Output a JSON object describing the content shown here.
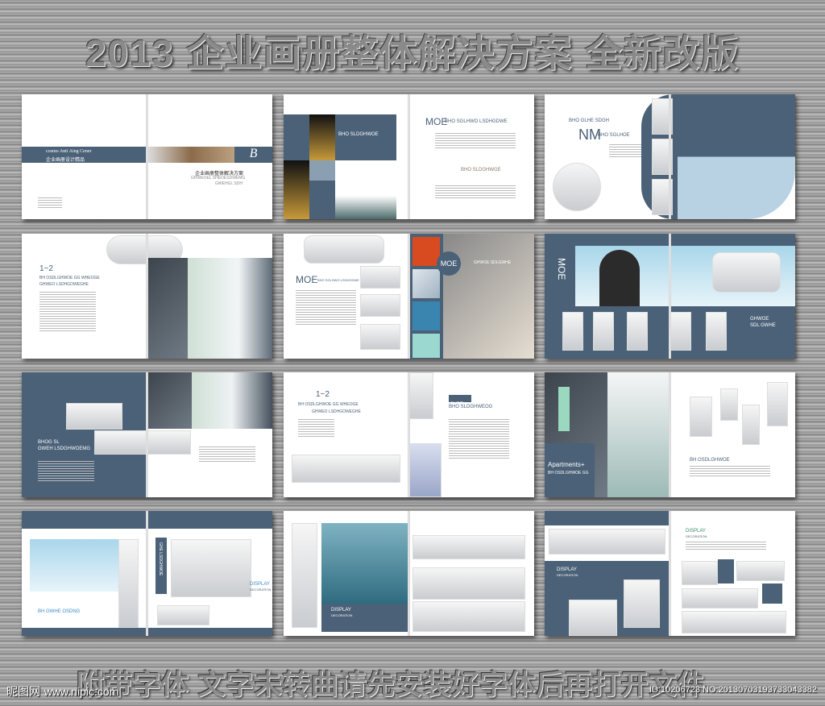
{
  "title": "2013 企业画册整体解决方案  全新改版",
  "footer": "附带字体 文字未转曲请先安装好字体后再打开文件",
  "watermark": {
    "logo": "昵图网",
    "url": "www.nipic.com",
    "id": "ID:10206723 NO:20130703193733043382"
  },
  "spreads": {
    "s1": {
      "band": "cosmo Anti Aing Cener",
      "band_cn": "企业画册设计精品",
      "letter": "B",
      "cover_cn": "企业画册整体解决方案",
      "cover_sub": "GHWEOEL SHEOESDWEMG",
      "cover_sub2": "GWEHGL SDH"
    },
    "s2": {
      "box": "BHO SLDGHWOE",
      "head_big": "MOE",
      "head": "BHO SGLHWO LSDHGDWE",
      "sub": "BHO SLDGHWGE"
    },
    "s3": {
      "head": "BHO GLHE SDGH",
      "big": "NM",
      "sub": "BHO SGLHOE"
    },
    "s4": {
      "num": "1~2",
      "head": "BH OSDLGHWOE GG   WHEOGE",
      "sub": "GHWEO LSDHGOWEGHE"
    },
    "s5": {
      "big": "MOE",
      "head": "BHO SGLHWO LSDHGDWE",
      "circle": "MOE",
      "tag": "GHWOE SDLGWHE"
    },
    "s6": {
      "vertical": "MOE",
      "head": "GHWOE",
      "sub": "SDL GWHE"
    },
    "s7": {
      "head": "BHOG SL",
      "sub": "GWEH LSDGHWOEMG"
    },
    "s8": {
      "num": "1~2",
      "head": "BH OSDLGHWOE GG   WHEOGE",
      "sub": "GHWEO LSDHGOWEGHE",
      "tag": "BVBT",
      "head2": "BHO SLDGHWEOG"
    },
    "s9": {
      "script": "Apartments+",
      "sub": "BH OSDLGHWOE GG",
      "head": "BH OSDLGHWOE"
    },
    "s10": {
      "vertical": "GHE LSDGHWOE",
      "display": "DISPLAY",
      "deco": "DECORATION",
      "head": "BH GWHE OSDNG"
    },
    "s11": {
      "display": "DISPLAY",
      "deco": "DECORATION"
    },
    "s12": {
      "display": "DISPLAY",
      "deco": "DECORATION",
      "display2": "DISPLAY",
      "deco2": "DECORATION"
    }
  }
}
